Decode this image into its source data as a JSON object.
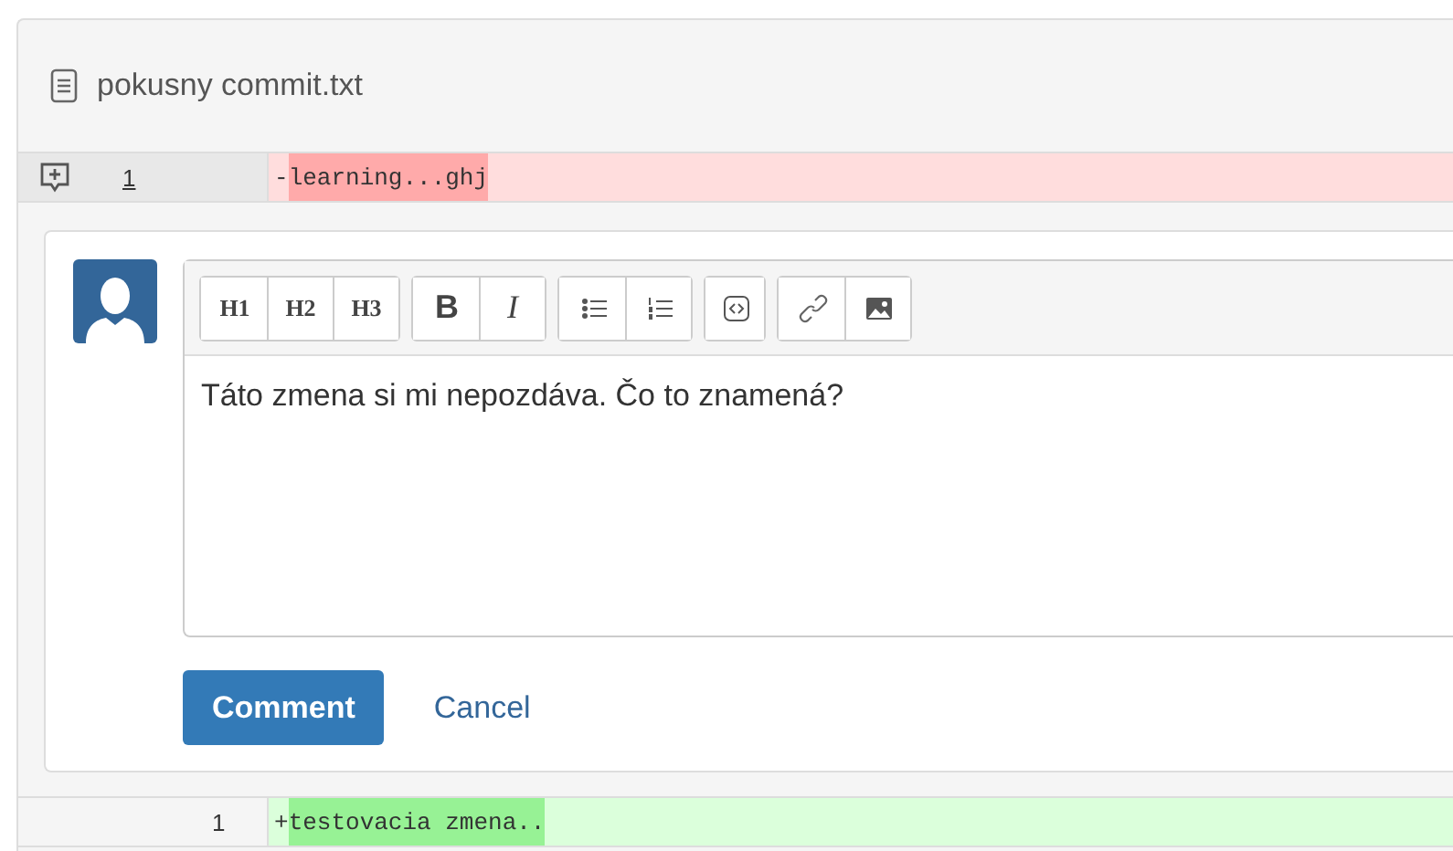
{
  "file": {
    "name": "pokusny commit.txt"
  },
  "deleted_line": {
    "old_number": "1",
    "sign": "-",
    "changed_text": "learning...ghj"
  },
  "comment_form": {
    "toolbar_text_groups": [
      [
        "H1",
        "H2",
        "H3"
      ],
      [
        "B",
        "I"
      ]
    ],
    "value": "Táto zmena si mi nepozdáva. Čo to znamená?",
    "buttons": {
      "submit": "Comment",
      "cancel": "Cancel"
    }
  },
  "added_line": {
    "new_number": "1",
    "sign": "+",
    "changed_text": "testovacia zmena.."
  }
}
